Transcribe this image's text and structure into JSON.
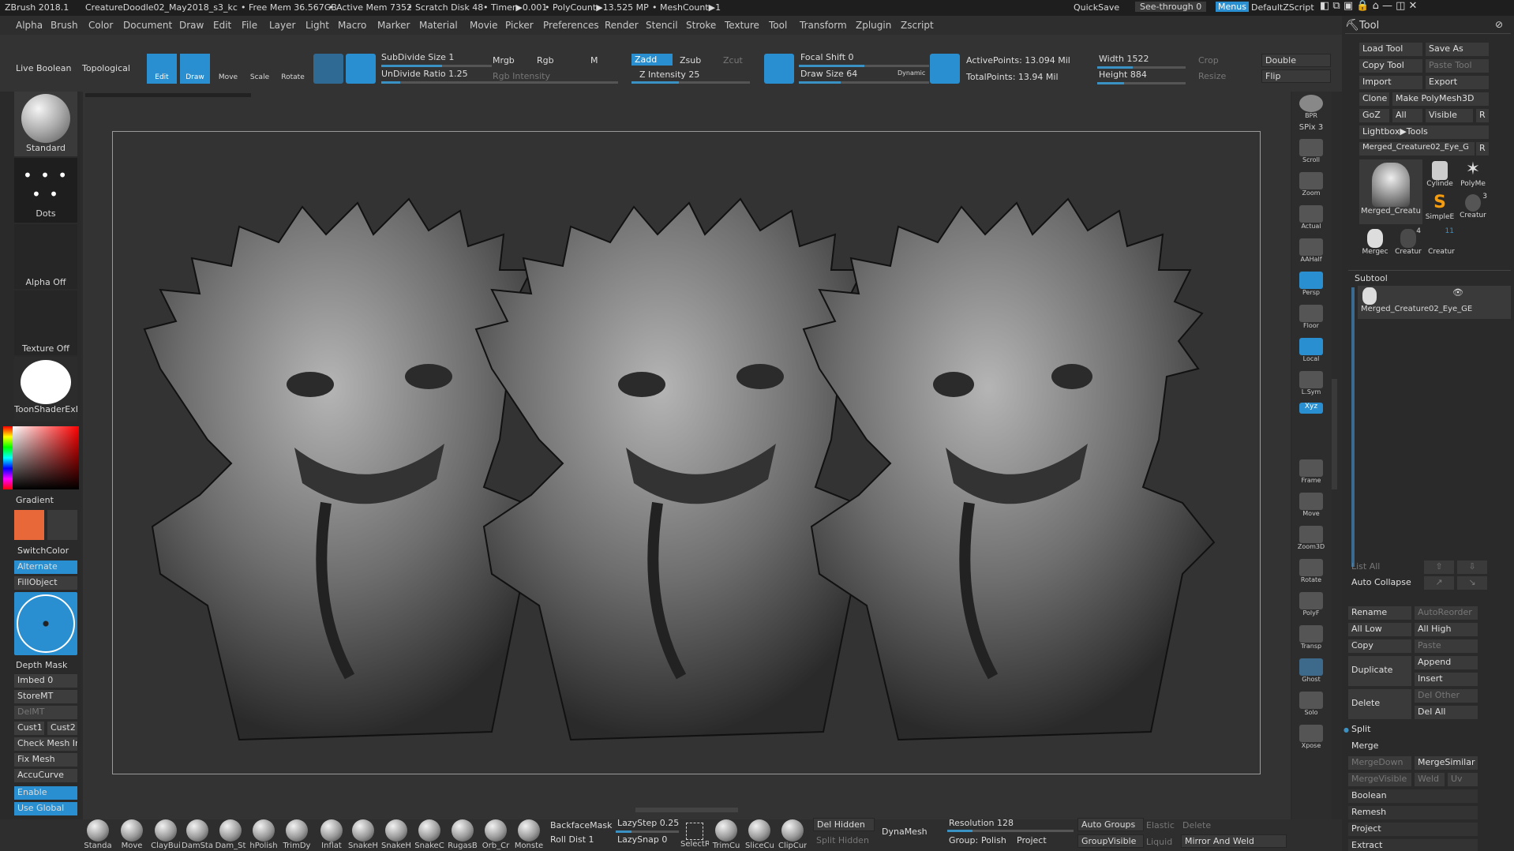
{
  "title": {
    "app": "ZBrush 2018.1",
    "file": "CreatureDoodle02_May2018_s3_kc",
    "free_mem": "• Free Mem 36.567GB",
    "active_mem": "• Active Mem 7352",
    "scratch": "• Scratch Disk 48",
    "timer": "• Timer▶0.001",
    "polycount": "• PolyCount▶13.525 MP",
    "meshcount": "• MeshCount▶1",
    "quicksave": "QuickSave",
    "see_through": "See-through  0",
    "menus": "Menus",
    "default_zscript": "DefaultZScript"
  },
  "menu": [
    "Alpha",
    "Brush",
    "Color",
    "Document",
    "Draw",
    "Edit",
    "File",
    "Layer",
    "Light",
    "Macro",
    "Marker",
    "Material",
    "Movie",
    "Picker",
    "Preferences",
    "Render",
    "Stencil",
    "Stroke",
    "Texture",
    "Tool",
    "Transform",
    "Zplugin",
    "Zscript"
  ],
  "topshelf": {
    "live_boolean": "Live Boolean",
    "topological": "Topological",
    "edit": "Edit",
    "draw": "Draw",
    "move": "Move",
    "scale": "Scale",
    "rotate": "Rotate",
    "subdivide_size": "SubDivide Size 1",
    "undivide_ratio": "UnDivide Ratio 1.25",
    "mrgb": "Mrgb",
    "rgb": "Rgb",
    "m": "M",
    "rgb_intensity": "Rgb Intensity",
    "zadd": "Zadd",
    "zsub": "Zsub",
    "zcut": "Zcut",
    "z_intensity": "Z Intensity 25",
    "focal_shift": "Focal Shift 0",
    "draw_size": "Draw Size 64",
    "dynamic": "Dynamic",
    "active_points": "ActivePoints: 13.094 Mil",
    "total_points": "TotalPoints: 13.94 Mil",
    "width": "Width 1522",
    "height": "Height 884",
    "crop": "Crop",
    "resize": "Resize",
    "double": "Double",
    "flip": "Flip"
  },
  "leftshelf": {
    "standard": "Standard",
    "dots": "Dots",
    "alpha_off": "Alpha Off",
    "texture_off": "Texture Off",
    "material": "ToonShaderExF",
    "gradient": "Gradient",
    "switch_color": "SwitchColor",
    "alternate": "Alternate",
    "fill_object": "FillObject",
    "depth_mask": "Depth Mask",
    "imbed": "Imbed 0",
    "store_mt": "StoreMT",
    "del_mt": "DelMT",
    "cust1": "Cust1",
    "cust2": "Cust2",
    "check_mesh": "Check Mesh In",
    "fix_mesh": "Fix Mesh",
    "accucurve": "AccuCurve",
    "enable": "Enable",
    "use_global": "Use Global",
    "main_color": "#e8683a",
    "secondary_color": "#3a3a3a"
  },
  "rightshelf": [
    "BPR",
    "SPix 3",
    "Scroll",
    "Zoom",
    "Actual",
    "AAHalf",
    "Persp",
    "Floor",
    "Local",
    "L.Sym",
    "Xyz",
    "Frame",
    "Move",
    "Zoom3D",
    "Rotate",
    "PolyF",
    "Transp",
    "Ghost",
    "Solo",
    "Xpose"
  ],
  "tool": {
    "title": "Tool",
    "load_tool": "Load Tool",
    "save_as": "Save As",
    "copy_tool": "Copy Tool",
    "paste_tool": "Paste Tool",
    "import": "Import",
    "export": "Export",
    "clone": "Clone",
    "make_polymesh": "Make PolyMesh3D",
    "goz": "GoZ",
    "all": "All",
    "visible": "Visible",
    "r": "R",
    "lightbox_tools": "Lightbox▶Tools",
    "current_tool": "Merged_Creature02_Eye_G",
    "thumbs": [
      "Merged_Creatu",
      "Cylinde",
      "PolyMe",
      "SimpleE",
      "Creatur",
      "Mergec",
      "Creatur",
      "Creatur"
    ],
    "thumb_counts": [
      "3",
      "4",
      "11"
    ],
    "subtool_header": "Subtool",
    "subtool_item": "Merged_Creature02_Eye_GE",
    "list_all": "List All",
    "auto_collapse": "Auto Collapse",
    "rename": "Rename",
    "autoreorder": "AutoReorder",
    "all_low": "All Low",
    "all_high": "All High",
    "copy": "Copy",
    "paste": "Paste",
    "duplicate": "Duplicate",
    "append": "Append",
    "insert": "Insert",
    "delete": "Delete",
    "del_other": "Del Other",
    "del_all": "Del All",
    "split": "Split",
    "merge": "Merge",
    "merge_down": "MergeDown",
    "merge_similar": "MergeSimilar",
    "merge_visible": "MergeVisible",
    "weld": "Weld",
    "uv": "Uv",
    "boolean": "Boolean",
    "remesh": "Remesh",
    "project": "Project",
    "extract": "Extract"
  },
  "bottom": {
    "brushes": [
      "Standa",
      "Move",
      "ClayBui",
      "DamSta",
      "Dam_St",
      "hPolish",
      "TrimDy",
      "Inflat",
      "SnakeH",
      "SnakeH",
      "SnakeC",
      "RugasB",
      "Orb_Cr",
      "Monste"
    ],
    "backface_mask": "BackfaceMask",
    "lazy_step": "LazyStep 0.25",
    "roll_dist": "Roll Dist 1",
    "lazy_snap": "LazySnap 0",
    "select_rect": "SelectRe",
    "trim_curve": "TrimCu",
    "slice_curve": "SliceCu",
    "clip_curve": "ClipCur",
    "del_hidden": "Del Hidden",
    "split_hidden": "Split Hidden",
    "dynamesh": "DynaMesh",
    "resolution": "Resolution 128",
    "group": "Group:",
    "polish": "Polish",
    "project": "Project",
    "auto_groups": "Auto Groups",
    "group_visible": "GroupVisible",
    "elastic": "Elastic",
    "liquid": "Liquid",
    "delete": "Delete",
    "mirror_weld": "Mirror And Weld"
  }
}
